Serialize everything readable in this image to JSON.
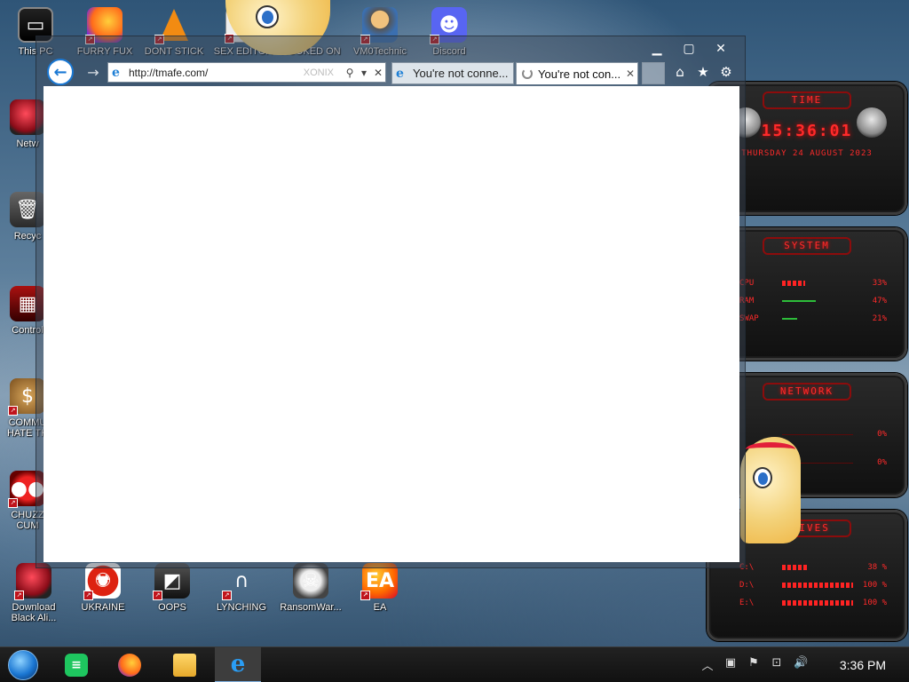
{
  "desktop": {
    "top_icons": [
      {
        "label": "This PC",
        "icon": "computer-icon"
      },
      {
        "label": "FURRY FUX",
        "icon": "firefox-icon"
      },
      {
        "label": "DONT STICK",
        "icon": "vlc-cone-icon"
      },
      {
        "label": "SEX EDITOR",
        "icon": "document-icon"
      },
      {
        "label": "HOOKED ON",
        "icon": "cartoon-icon"
      },
      {
        "label": "VM0Technic",
        "icon": "user-avatar-icon"
      },
      {
        "label": "Discord",
        "icon": "discord-icon"
      }
    ],
    "left_icons": [
      {
        "label": "Netw",
        "icon": "network-orb-icon"
      },
      {
        "label": "Recyc",
        "icon": "recycle-bin-icon"
      },
      {
        "label": "Control",
        "icon": "control-panel-icon"
      },
      {
        "label": "COMMU\nHATE TH",
        "icon": "money-bag-icon"
      },
      {
        "label": "CHUZZ\nCUM",
        "icon": "chuzzle-icon"
      }
    ],
    "bottom_icons": [
      {
        "label": "Download\nBlack Ali...",
        "icon": "alien-orb-icon"
      },
      {
        "label": "UKRAINE",
        "icon": "radiation-icon"
      },
      {
        "label": "OOPS",
        "icon": "oops-icon"
      },
      {
        "label": "LYNCHING",
        "icon": "noose-icon"
      },
      {
        "label": "RansomWar...",
        "icon": "skull-icon"
      },
      {
        "label": "EA",
        "icon": "ea-icon"
      }
    ]
  },
  "browser": {
    "address": "http://tmafe.com/",
    "search_ghost": "XONIX",
    "tabs": [
      {
        "title": "You're not conne...",
        "state": "inactive"
      },
      {
        "title": "You're not con...",
        "state": "loading"
      }
    ]
  },
  "gadgets": {
    "time": {
      "header": "TIME",
      "clock": "15:36:01",
      "date": "THURSDAY 24 AUGUST 2023"
    },
    "system": {
      "header": "SYSTEM",
      "rows": [
        {
          "name": "CPU",
          "value": "33%",
          "fraction": 0.33
        },
        {
          "name": "RAM",
          "value": "47%",
          "fraction": 0.47
        },
        {
          "name": "SWAP",
          "value": "21%",
          "fraction": 0.21
        }
      ]
    },
    "network": {
      "header": "NETWORK",
      "rows": [
        {
          "value": "0%"
        },
        {
          "value": "0%"
        }
      ]
    },
    "drives": {
      "header": "DRIVES",
      "rows": [
        {
          "name": "C:\\",
          "value": "38 %",
          "fraction": 0.38
        },
        {
          "name": "D:\\",
          "value": "100 %",
          "fraction": 1.0
        },
        {
          "name": "E:\\",
          "value": "100 %",
          "fraction": 1.0
        }
      ]
    }
  },
  "taskbar": {
    "clock": "3:36 PM"
  },
  "colors": {
    "gadget_red": "#ff2a2a",
    "ie_blue": "#1a78d4",
    "taskbar": "#161616"
  }
}
